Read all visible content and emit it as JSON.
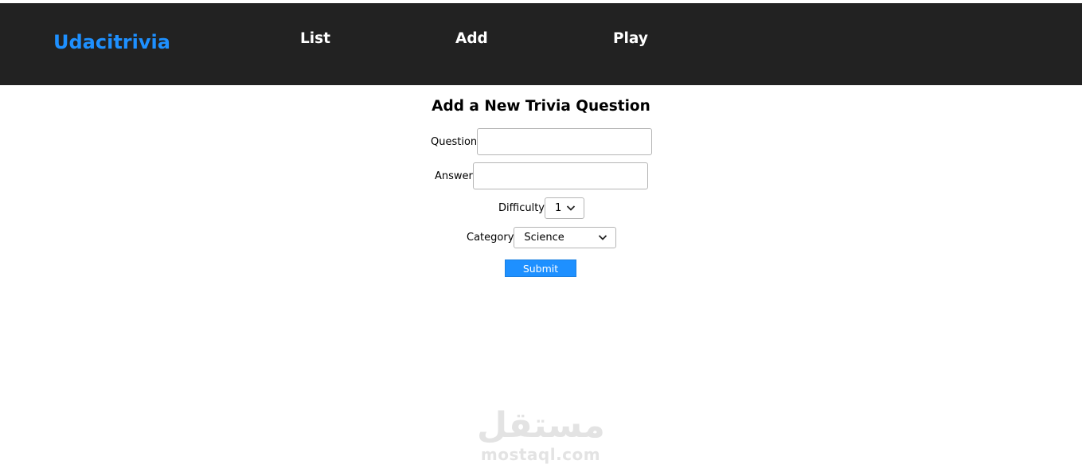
{
  "navbar": {
    "brand": "Udacitrivia",
    "links": [
      "List",
      "Add",
      "Play"
    ]
  },
  "form": {
    "title": "Add a New Trivia Question",
    "question_label": "Question",
    "question_value": "",
    "answer_label": "Answer",
    "answer_value": "",
    "difficulty_label": "Difficulty",
    "difficulty_value": "1",
    "category_label": "Category",
    "category_value": "Science",
    "submit_label": "Submit"
  },
  "watermark": {
    "arabic": "مستقل",
    "latin": "mostaql.com"
  },
  "colors": {
    "navbar_bg": "#222222",
    "brand": "#1e90ff",
    "submit_bg": "#1e90ff"
  },
  "icons": {
    "select_arrow": "chevron-down-icon"
  }
}
